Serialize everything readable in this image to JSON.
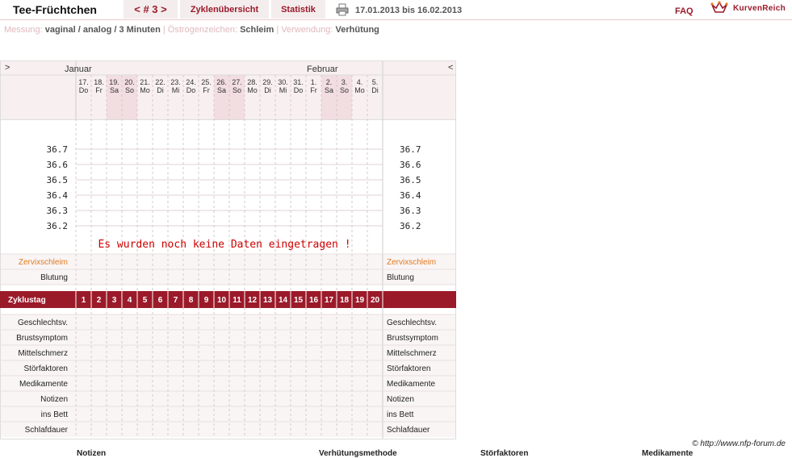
{
  "header": {
    "title": "Tee-Früchtchen",
    "cycle_nav": "< # 3 >",
    "tab_zyklen": "Zyklenübersicht",
    "tab_statistik": "Statistik",
    "date_range": "17.01.2013 bis 16.02.2013",
    "faq": "FAQ",
    "brand": "KurvenReich"
  },
  "info": {
    "messung_label": "Messung:",
    "messung_value": "vaginal / analog / 3 Minuten",
    "oestrogen_label": "Östrogenzeichen:",
    "oestrogen_value": "Schleim",
    "verwendung_label": "Verwendung:",
    "verwendung_value": "Verhütung",
    "sep": "|"
  },
  "chart": {
    "nav_left": ">",
    "nav_right": "<",
    "month1": "Januar",
    "month2": "Februar",
    "days": [
      {
        "num": "17.",
        "dow": "Do",
        "weekend": false
      },
      {
        "num": "18.",
        "dow": "Fr",
        "weekend": false
      },
      {
        "num": "19.",
        "dow": "Sa",
        "weekend": true
      },
      {
        "num": "20.",
        "dow": "So",
        "weekend": true
      },
      {
        "num": "21.",
        "dow": "Mo",
        "weekend": false
      },
      {
        "num": "22.",
        "dow": "Di",
        "weekend": false
      },
      {
        "num": "23.",
        "dow": "Mi",
        "weekend": false
      },
      {
        "num": "24.",
        "dow": "Do",
        "weekend": false
      },
      {
        "num": "25.",
        "dow": "Fr",
        "weekend": false
      },
      {
        "num": "26.",
        "dow": "Sa",
        "weekend": true
      },
      {
        "num": "27.",
        "dow": "So",
        "weekend": true
      },
      {
        "num": "28.",
        "dow": "Mo",
        "weekend": false
      },
      {
        "num": "29.",
        "dow": "Di",
        "weekend": false
      },
      {
        "num": "30.",
        "dow": "Mi",
        "weekend": false
      },
      {
        "num": "31.",
        "dow": "Do",
        "weekend": false
      },
      {
        "num": "1.",
        "dow": "Fr",
        "weekend": false
      },
      {
        "num": "2.",
        "dow": "Sa",
        "weekend": true
      },
      {
        "num": "3.",
        "dow": "So",
        "weekend": true
      },
      {
        "num": "4.",
        "dow": "Mo",
        "weekend": false
      },
      {
        "num": "5.",
        "dow": "Di",
        "weekend": false
      }
    ],
    "temps": [
      "36.7",
      "36.6",
      "36.5",
      "36.4",
      "36.3",
      "36.2"
    ],
    "no_data": "Es wurden noch keine Daten eingetragen !",
    "zervix_label": "Zervixschleim",
    "blutung_label": "Blutung",
    "zyklustag_label": "Zyklustag",
    "cycle_days": [
      "1",
      "2",
      "3",
      "4",
      "5",
      "6",
      "7",
      "8",
      "9",
      "10",
      "11",
      "12",
      "13",
      "14",
      "15",
      "16",
      "17",
      "18",
      "19",
      "20"
    ],
    "bottom_rows": [
      "Geschlechtsv.",
      "Brustsymptom",
      "Mittelschmerz",
      "Störfaktoren",
      "Medikamente",
      "Notizen",
      "ins Bett",
      "Schlafdauer"
    ]
  },
  "footer": {
    "credit": "© http://www.nfp-forum.de",
    "col1": "Notizen",
    "col2": "Verhütungsmethode",
    "col3": "Störfaktoren",
    "col4": "Medikamente"
  },
  "colors": {
    "accent": "#9b1a2a",
    "zervix": "#e07a20",
    "header_bg": "#f8f0f0",
    "weekend_bg": "#f2dde0",
    "no_data_text": "#cc0000"
  }
}
